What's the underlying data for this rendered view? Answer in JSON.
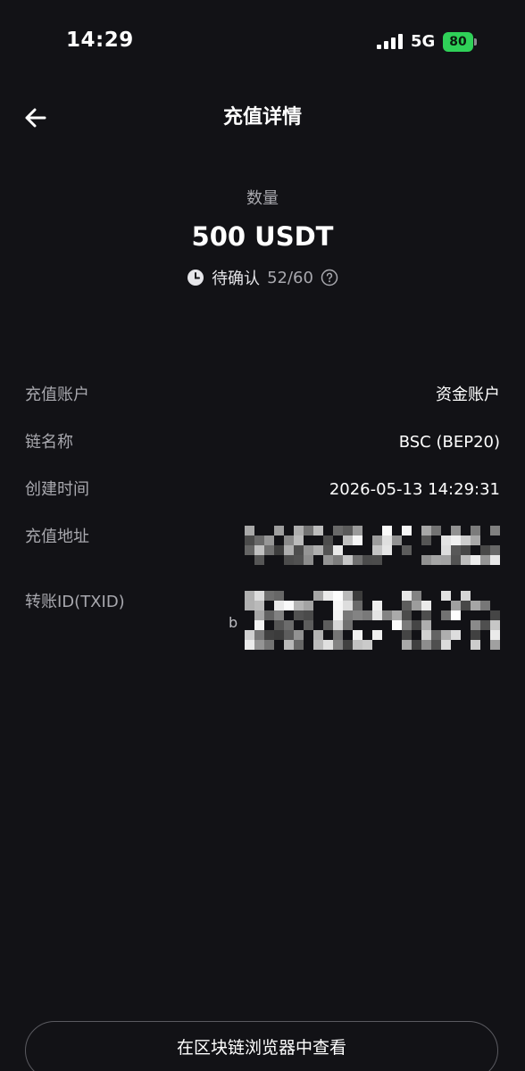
{
  "status_bar": {
    "time": "14:29",
    "network": "5G",
    "battery": "80"
  },
  "header": {
    "title": "充值详情"
  },
  "summary": {
    "amount_label": "数量",
    "amount_value": "500 USDT",
    "status_text": "待确认",
    "confirmations": "52/60"
  },
  "details": {
    "account": {
      "label": "充值账户",
      "value": "资金账户"
    },
    "chain": {
      "label": "链名称",
      "value": "BSC (BEP20)"
    },
    "created": {
      "label": "创建时间",
      "value": "2026-05-13 14:29:31"
    },
    "address": {
      "label": "充值地址"
    },
    "txid": {
      "label": "转账ID(TXID)",
      "prefix": "b"
    }
  },
  "footer": {
    "explorer_label": "在区块链浏览器中查看"
  },
  "colors": {
    "background": "#121216",
    "label_gray": "#a8a8ae",
    "battery_green": "#2fd158"
  }
}
